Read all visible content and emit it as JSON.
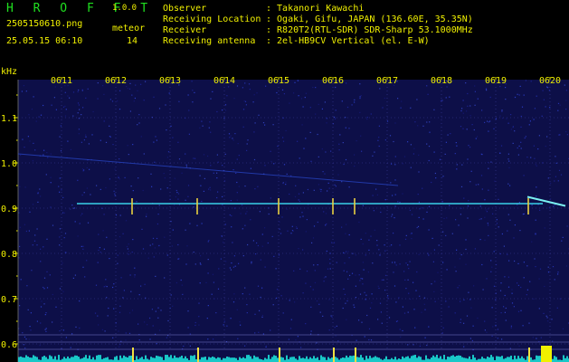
{
  "app": {
    "title": "H R O F F T",
    "version": "1.0.0"
  },
  "file": {
    "name": "2505150610.png",
    "datetime": "25.05.15 06:10"
  },
  "meteor": {
    "label": "meteor",
    "count": "14"
  },
  "info": [
    {
      "label": "Observer",
      "value": ": Takanori Kawachi"
    },
    {
      "label": "Receiving Location",
      "value": ": Ogaki, Gifu, JAPAN (136.60E, 35.35N)"
    },
    {
      "label": "Receiver",
      "value": ": R820T2(RTL-SDR) SDR-Sharp 53.1000MHz"
    },
    {
      "label": "Receiving antenna",
      "value": ": 2el-HB9CV Vertical (el. E-W)"
    }
  ],
  "colors": {
    "text_green": "#20e020",
    "text_yellow": "#f0f000",
    "background": "#000000",
    "noise": "#1a1f8a"
  },
  "chart_data": {
    "type": "heatmap",
    "yunit": "kHz",
    "xlabels": [
      "0611",
      "0612",
      "0613",
      "0614",
      "0615",
      "0616",
      "0617",
      "0618",
      "0619",
      "0620"
    ],
    "yticks": [
      "1.1",
      "1.0",
      "0.9",
      "0.8",
      "0.7",
      "0.6"
    ],
    "ylim": [
      0.58,
      1.18
    ],
    "carrier_khz": 0.91,
    "meteor_minutes": [
      12.3,
      13.5,
      15.0,
      16.0,
      16.4,
      19.6
    ]
  }
}
